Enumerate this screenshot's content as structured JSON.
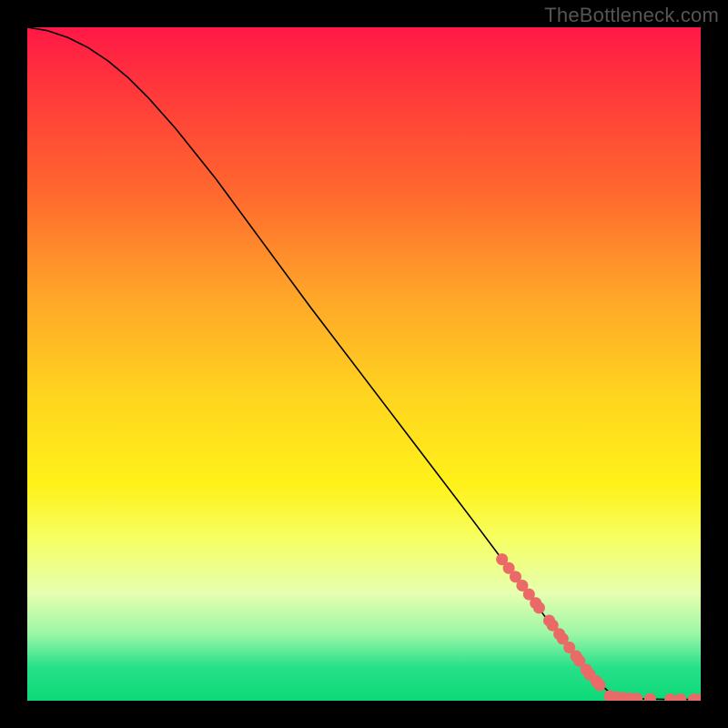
{
  "watermark": "TheBottleneck.com",
  "chart_data": {
    "type": "line",
    "title": "",
    "xlabel": "",
    "ylabel": "",
    "xlim": [
      0,
      100
    ],
    "ylim": [
      0,
      100
    ],
    "curve": [
      {
        "x": 0,
        "y": 100
      },
      {
        "x": 3,
        "y": 99.5
      },
      {
        "x": 6,
        "y": 98.5
      },
      {
        "x": 9,
        "y": 97
      },
      {
        "x": 12,
        "y": 95
      },
      {
        "x": 15,
        "y": 92.5
      },
      {
        "x": 18,
        "y": 89.5
      },
      {
        "x": 22,
        "y": 85
      },
      {
        "x": 28,
        "y": 77.5
      },
      {
        "x": 35,
        "y": 68
      },
      {
        "x": 42,
        "y": 58.5
      },
      {
        "x": 50,
        "y": 48
      },
      {
        "x": 58,
        "y": 37.5
      },
      {
        "x": 66,
        "y": 27
      },
      {
        "x": 72,
        "y": 19
      },
      {
        "x": 78,
        "y": 11
      },
      {
        "x": 82,
        "y": 6
      },
      {
        "x": 85,
        "y": 2.5
      },
      {
        "x": 87,
        "y": 0.8
      },
      {
        "x": 90,
        "y": 0.3
      },
      {
        "x": 95,
        "y": 0.2
      },
      {
        "x": 100,
        "y": 0.2
      }
    ],
    "markers_thick_segment": [
      {
        "x": 70.5,
        "y": 21.0
      },
      {
        "x": 71.5,
        "y": 19.7
      },
      {
        "x": 72.5,
        "y": 18.4
      },
      {
        "x": 73.5,
        "y": 17.1
      },
      {
        "x": 74.5,
        "y": 15.8
      },
      {
        "x": 75.5,
        "y": 14.5
      },
      {
        "x": 76.0,
        "y": 13.8
      },
      {
        "x": 77.5,
        "y": 11.9
      },
      {
        "x": 78.0,
        "y": 11.2
      },
      {
        "x": 79.0,
        "y": 9.9
      },
      {
        "x": 79.5,
        "y": 9.2
      },
      {
        "x": 80.5,
        "y": 7.9
      },
      {
        "x": 81.5,
        "y": 6.6
      },
      {
        "x": 82.0,
        "y": 5.9
      },
      {
        "x": 83.0,
        "y": 4.6
      },
      {
        "x": 83.5,
        "y": 3.9
      },
      {
        "x": 84.5,
        "y": 2.9
      },
      {
        "x": 85.0,
        "y": 2.3
      }
    ],
    "markers_bottom": [
      {
        "x": 86.5,
        "y": 0.7
      },
      {
        "x": 87.5,
        "y": 0.5
      },
      {
        "x": 88.5,
        "y": 0.4
      },
      {
        "x": 89.5,
        "y": 0.35
      },
      {
        "x": 90.5,
        "y": 0.3
      },
      {
        "x": 92.5,
        "y": 0.25
      },
      {
        "x": 95.5,
        "y": 0.2
      },
      {
        "x": 97.0,
        "y": 0.2
      },
      {
        "x": 99.0,
        "y": 0.2
      },
      {
        "x": 100.0,
        "y": 0.2
      }
    ],
    "marker_color": "#e96a66"
  }
}
